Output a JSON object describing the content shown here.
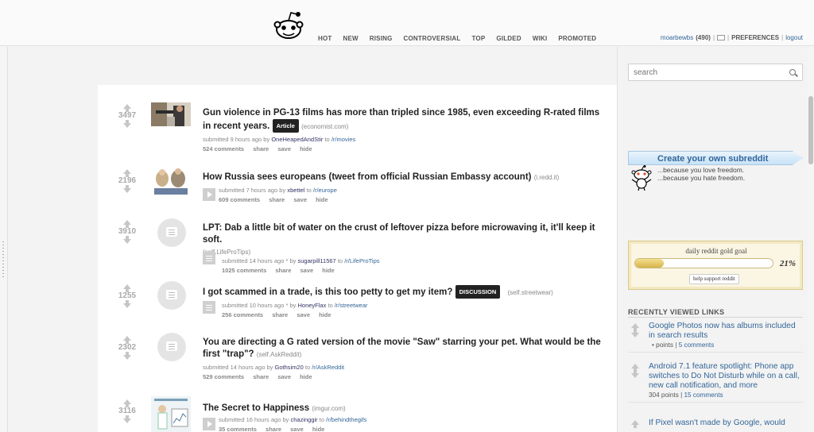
{
  "header": {
    "tabs": [
      "HOT",
      "NEW",
      "RISING",
      "CONTROVERSIAL",
      "TOP",
      "GILDED",
      "WIKI",
      "PROMOTED"
    ],
    "username": "moarbewbs",
    "karma": "(490)",
    "preferences": "PREFERENCES",
    "logout": "logout"
  },
  "posts": [
    {
      "score": "3497",
      "title": "Gun violence in PG-13 films has more than tripled since 1985, even exceeding R-rated films in recent years.",
      "flair": "Article",
      "domain": "(economist.com)",
      "submitted": "submitted 9 hours ago by",
      "author": "OneHeapedAndStir",
      "to": "to",
      "subreddit": "/r/movies",
      "comments": "524 comments",
      "share": "share",
      "save": "save",
      "hide": "hide"
    },
    {
      "score": "2196",
      "title": "How Russia sees europeans (tweet from official Russian Embassy account)",
      "domain": "(i.redd.it)",
      "submitted": "submitted 7 hours ago by",
      "author": "xbettel",
      "to": "to",
      "subreddit": "/r/europe",
      "comments": "609 comments",
      "share": "share",
      "save": "save",
      "hide": "hide"
    },
    {
      "score": "3910",
      "title": "LPT: Dab a little bit of water on the crust of leftover pizza before microwaving it, it'll keep it soft.",
      "domain": "(self.LifeProTips)",
      "submitted": "submitted 14 hours ago * by",
      "author": "sugarpill11567",
      "to": "to",
      "subreddit": "/r/LifeProTips",
      "comments": "1025 comments",
      "share": "share",
      "save": "save",
      "hide": "hide"
    },
    {
      "score": "1255",
      "title": "I got scammed in a trade, is this too petty to get my item?",
      "flair": "DISCUSSION",
      "domain": "(self.streetwear)",
      "submitted": "submitted 10 hours ago * by",
      "author": "HoneyFlax",
      "to": "to",
      "subreddit": "/r/streetwear",
      "comments": "256 comments",
      "share": "share",
      "save": "save",
      "hide": "hide"
    },
    {
      "score": "2302",
      "title": "You are directing a G rated version of the movie \"Saw\" starring your pet. What would be the first \"trap\"?",
      "domain": "(self.AskReddit)",
      "submitted": "submitted 14 hours ago by",
      "author": "Gothsim20",
      "to": "to",
      "subreddit": "/r/AskReddit",
      "comments": "529 comments",
      "share": "share",
      "save": "save",
      "hide": "hide"
    },
    {
      "score": "3116",
      "title": "The Secret to Happiness",
      "domain": "(imgur.com)",
      "submitted": "submitted 16 hours ago by",
      "author": "chazinggir",
      "to": "to",
      "subreddit": "/r/behindthegifs",
      "comments": "35 comments",
      "share": "share",
      "save": "save",
      "hide": "hide"
    }
  ],
  "sidebar": {
    "search_placeholder": "search",
    "create_title": "Create your own subreddit",
    "create_line1": "...because you love freedom.",
    "create_line2": "...because you hate freedom.",
    "gold_title": "daily reddit gold goal",
    "gold_progress": 0.21,
    "gold_pct": "21%",
    "gold_button": "help support reddit",
    "recent_title": "RECENTLY VIEWED LINKS",
    "recent": [
      {
        "title": "Google Photos now has albums included in search results",
        "points": "• points",
        "sep": "|",
        "comments": "5 comments"
      },
      {
        "title": "Android 7.1 feature spotlight: Phone app switches to Do Not Disturb while on a call, new call notification, and more",
        "points": "304 points",
        "sep": "|",
        "comments": "15 comments"
      },
      {
        "title": "If Pixel wasn't made by Google, would",
        "points": "",
        "sep": "",
        "comments": ""
      }
    ]
  },
  "colors": {
    "link": "#336699",
    "gold": "#d6b34a",
    "score": "#a9a9a9"
  }
}
